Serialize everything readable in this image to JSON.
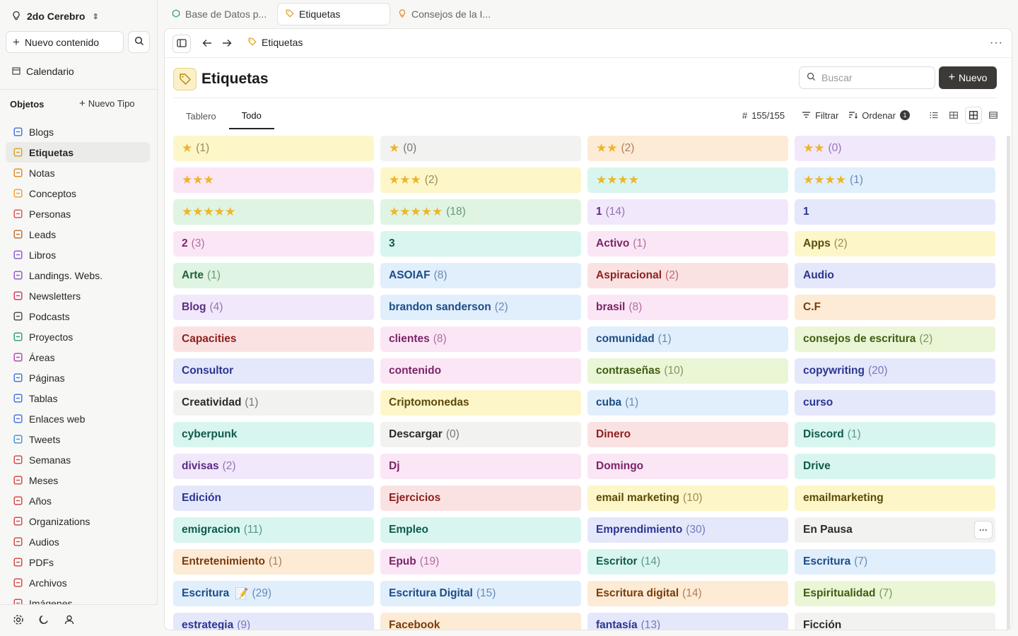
{
  "workspace": {
    "name": "2do Cerebro"
  },
  "sidebar": {
    "new_content": "Nuevo contenido",
    "calendar": "Calendario",
    "objects_label": "Objetos",
    "new_type": "Nuevo Tipo",
    "items": [
      {
        "label": "Blogs",
        "icon": "edit-icon",
        "color": "#3b6fd8"
      },
      {
        "label": "Etiquetas",
        "icon": "tag-icon",
        "color": "#d8a01e"
      },
      {
        "label": "Notas",
        "icon": "lightbulb-icon",
        "color": "#e2871c"
      },
      {
        "label": "Conceptos",
        "icon": "spark-icon",
        "color": "#f0a020"
      },
      {
        "label": "Personas",
        "icon": "person-icon",
        "color": "#e04a4a"
      },
      {
        "label": "Leads",
        "icon": "leads-icon",
        "color": "#c2682a"
      },
      {
        "label": "Libros",
        "icon": "book-icon",
        "color": "#8a4fd1"
      },
      {
        "label": "Landings. Webs.",
        "icon": "book-open-icon",
        "color": "#8a4fd1"
      },
      {
        "label": "Newsletters",
        "icon": "mail-icon",
        "color": "#d2304f"
      },
      {
        "label": "Podcasts",
        "icon": "microphone-icon",
        "color": "#444444"
      },
      {
        "label": "Proyectos",
        "icon": "cube-icon",
        "color": "#2a9a6a"
      },
      {
        "label": "Áreas",
        "icon": "area-icon",
        "color": "#b03da8"
      },
      {
        "label": "Páginas",
        "icon": "page-icon",
        "color": "#3b6fd8"
      },
      {
        "label": "Tablas",
        "icon": "table-icon",
        "color": "#3b6fd8"
      },
      {
        "label": "Enlaces web",
        "icon": "globe-icon",
        "color": "#3b6fd8"
      },
      {
        "label": "Tweets",
        "icon": "bird-icon",
        "color": "#3b8fd8"
      },
      {
        "label": "Semanas",
        "icon": "week-icon",
        "color": "#d04040"
      },
      {
        "label": "Meses",
        "icon": "calendar-month-icon",
        "color": "#d04040"
      },
      {
        "label": "Años",
        "icon": "calendar-year-icon",
        "color": "#d04040"
      },
      {
        "label": "Organizations",
        "icon": "building-icon",
        "color": "#d04040"
      },
      {
        "label": "Audios",
        "icon": "waveform-icon",
        "color": "#d04040"
      },
      {
        "label": "PDFs",
        "icon": "pdf-icon",
        "color": "#d04040"
      },
      {
        "label": "Archivos",
        "icon": "file-icon",
        "color": "#d04040"
      },
      {
        "label": "Imágenes",
        "icon": "image-icon",
        "color": "#d04040"
      }
    ],
    "active_index": 1
  },
  "tabs": [
    {
      "label": "Base de Datos p...",
      "icon": "cube-icon"
    },
    {
      "label": "Etiquetas",
      "icon": "tag-icon"
    },
    {
      "label": "Consejos de la I...",
      "icon": "lightbulb-icon"
    }
  ],
  "breadcrumb": {
    "label": "Etiquetas"
  },
  "page": {
    "title": "Etiquetas",
    "search_placeholder": "Buscar",
    "new_button": "Nuevo"
  },
  "view_tabs": [
    "Tablero",
    "Todo"
  ],
  "toolbar": {
    "count": "155/155",
    "filter": "Filtrar",
    "sort": "Ordenar",
    "sort_badge": "1"
  },
  "cards": [
    {
      "stars": 1,
      "label": "",
      "count": "(1)",
      "color": "yellow"
    },
    {
      "stars": 1,
      "label": "",
      "count": "(0)",
      "color": "gray"
    },
    {
      "stars": 2,
      "label": "",
      "count": "(2)",
      "color": "orange"
    },
    {
      "stars": 2,
      "label": "",
      "count": "(0)",
      "color": "purple"
    },
    {
      "stars": 3,
      "label": "",
      "count": "",
      "color": "pink"
    },
    {
      "stars": 3,
      "label": "",
      "count": "(2)",
      "color": "yellow"
    },
    {
      "stars": 4,
      "label": "",
      "count": "",
      "color": "teal"
    },
    {
      "stars": 4,
      "label": "",
      "count": "(1)",
      "color": "blue"
    },
    {
      "stars": 5,
      "label": "",
      "count": "",
      "color": "green"
    },
    {
      "stars": 5,
      "label": "",
      "count": "(18)",
      "color": "green"
    },
    {
      "stars": 0,
      "label": "1",
      "count": "(14)",
      "color": "purple"
    },
    {
      "stars": 0,
      "label": "1",
      "count": "",
      "color": "indigo"
    },
    {
      "stars": 0,
      "label": "2",
      "count": "(3)",
      "color": "pink"
    },
    {
      "stars": 0,
      "label": "3",
      "count": "",
      "color": "teal"
    },
    {
      "stars": 0,
      "label": "Activo",
      "count": "(1)",
      "color": "pink"
    },
    {
      "stars": 0,
      "label": "Apps",
      "count": "(2)",
      "color": "yellow"
    },
    {
      "stars": 0,
      "label": "Arte",
      "count": "(1)",
      "color": "green"
    },
    {
      "stars": 0,
      "label": "ASOIAF",
      "count": "(8)",
      "color": "blue"
    },
    {
      "stars": 0,
      "label": "Aspiracional",
      "count": "(2)",
      "color": "red"
    },
    {
      "stars": 0,
      "label": "Audio",
      "count": "",
      "color": "indigo"
    },
    {
      "stars": 0,
      "label": "Blog",
      "count": "(4)",
      "color": "purple"
    },
    {
      "stars": 0,
      "label": "brandon sanderson",
      "count": "(2)",
      "color": "blue"
    },
    {
      "stars": 0,
      "label": "brasil",
      "count": "(8)",
      "color": "pink"
    },
    {
      "stars": 0,
      "label": "C.F",
      "count": "",
      "color": "orange"
    },
    {
      "stars": 0,
      "label": "Capacities",
      "count": "",
      "color": "red"
    },
    {
      "stars": 0,
      "label": "clientes",
      "count": "(8)",
      "color": "pink"
    },
    {
      "stars": 0,
      "label": "comunidad",
      "count": "(1)",
      "color": "blue"
    },
    {
      "stars": 0,
      "label": "consejos de escritura",
      "count": "(2)",
      "color": "lime"
    },
    {
      "stars": 0,
      "label": "Consultor",
      "count": "",
      "color": "indigo"
    },
    {
      "stars": 0,
      "label": "contenido",
      "count": "",
      "color": "pink"
    },
    {
      "stars": 0,
      "label": "contraseñas",
      "count": "(10)",
      "color": "lime"
    },
    {
      "stars": 0,
      "label": "copywriting",
      "count": "(20)",
      "color": "indigo"
    },
    {
      "stars": 0,
      "label": "Creatividad",
      "count": "(1)",
      "color": "gray"
    },
    {
      "stars": 0,
      "label": "Criptomonedas",
      "count": "",
      "color": "yellow"
    },
    {
      "stars": 0,
      "label": "cuba",
      "count": "(1)",
      "color": "blue"
    },
    {
      "stars": 0,
      "label": "curso",
      "count": "",
      "color": "indigo"
    },
    {
      "stars": 0,
      "label": "cyberpunk",
      "count": "",
      "color": "teal"
    },
    {
      "stars": 0,
      "label": "Descargar",
      "count": "(0)",
      "color": "gray"
    },
    {
      "stars": 0,
      "label": "Dinero",
      "count": "",
      "color": "red"
    },
    {
      "stars": 0,
      "label": "Discord",
      "count": "(1)",
      "color": "teal"
    },
    {
      "stars": 0,
      "label": "divisas",
      "count": "(2)",
      "color": "purple"
    },
    {
      "stars": 0,
      "label": "Dj",
      "count": "",
      "color": "pink"
    },
    {
      "stars": 0,
      "label": "Domingo",
      "count": "",
      "color": "pink"
    },
    {
      "stars": 0,
      "label": "Drive",
      "count": "",
      "color": "teal"
    },
    {
      "stars": 0,
      "label": "Edición",
      "count": "",
      "color": "indigo"
    },
    {
      "stars": 0,
      "label": "Ejercicios",
      "count": "",
      "color": "red"
    },
    {
      "stars": 0,
      "label": "email marketing",
      "count": "(10)",
      "color": "yellow"
    },
    {
      "stars": 0,
      "label": "emailmarketing",
      "count": "",
      "color": "yellow"
    },
    {
      "stars": 0,
      "label": "emigracion",
      "count": "(11)",
      "color": "teal"
    },
    {
      "stars": 0,
      "label": "Empleo",
      "count": "",
      "color": "teal"
    },
    {
      "stars": 0,
      "label": "Emprendimiento",
      "count": "(30)",
      "color": "indigo"
    },
    {
      "stars": 0,
      "label": "En Pausa",
      "count": "",
      "color": "gray",
      "more": true
    },
    {
      "stars": 0,
      "label": "Entretenimiento",
      "count": "(1)",
      "color": "orange"
    },
    {
      "stars": 0,
      "label": "Epub",
      "count": "(19)",
      "color": "pink"
    },
    {
      "stars": 0,
      "label": "Escritor",
      "count": "(14)",
      "color": "teal"
    },
    {
      "stars": 0,
      "label": "Escritura",
      "count": "(7)",
      "color": "blue"
    },
    {
      "stars": 0,
      "label": "Escritura",
      "emoji": "📝",
      "count": "(29)",
      "color": "blue"
    },
    {
      "stars": 0,
      "label": "Escritura Digital",
      "count": "(15)",
      "color": "blue"
    },
    {
      "stars": 0,
      "label": "Escritura digital",
      "count": "(14)",
      "color": "orange"
    },
    {
      "stars": 0,
      "label": "Espiritualidad",
      "count": "(7)",
      "color": "lime"
    },
    {
      "stars": 0,
      "label": "estrategia",
      "count": "(9)",
      "color": "indigo"
    },
    {
      "stars": 0,
      "label": "Facebook",
      "count": "",
      "color": "orange"
    },
    {
      "stars": 0,
      "label": "fantasía",
      "count": "(13)",
      "color": "indigo"
    },
    {
      "stars": 0,
      "label": "Ficción",
      "count": "",
      "color": "gray"
    }
  ]
}
